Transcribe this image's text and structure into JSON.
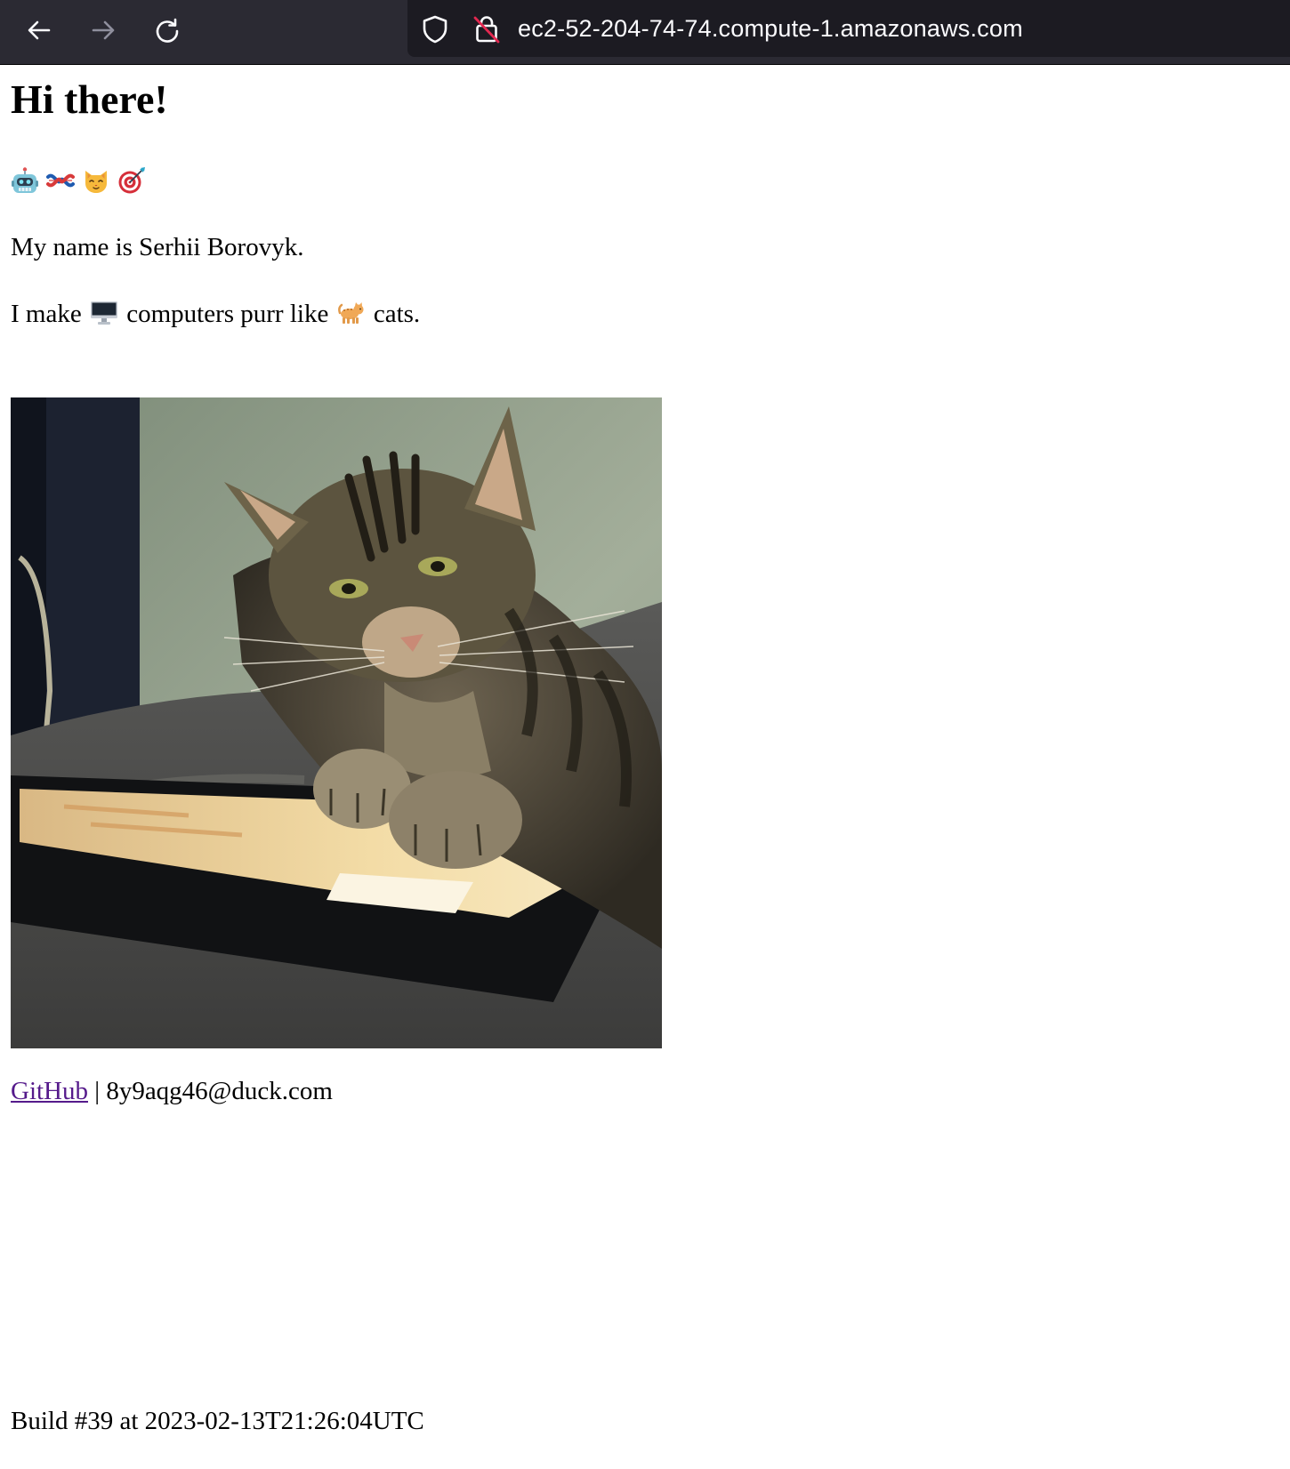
{
  "browser": {
    "url": "ec2-52-204-74-74.compute-1.amazonaws.com",
    "icons": [
      "back-arrow-icon",
      "forward-arrow-icon",
      "reload-icon",
      "shield-icon",
      "insecure-lock-icon"
    ],
    "toolbar_color": "#2b2a33",
    "url_bar_color": "#1c1b22"
  },
  "page": {
    "title": "Hi there!",
    "emojis": [
      "robot-emoji",
      "ukraine-knot-emoji",
      "cat-face-emoji",
      "target-emoji"
    ],
    "name_line": "My name is Serhii Borovyk.",
    "purr_line": {
      "before": "I make",
      "middle": "computers purr like",
      "after": "cats.",
      "icons": [
        "desktop-computer-icon",
        "cat-icon"
      ]
    },
    "photo_subject": "tabby cat pawing a tablet",
    "links": {
      "github_label": "GitHub",
      "separator": "|",
      "email": "8y9aqg46@duck.com",
      "link_color": "#551a8b"
    },
    "build_line": "Build #39 at 2023-02-13T21:26:04UTC"
  }
}
